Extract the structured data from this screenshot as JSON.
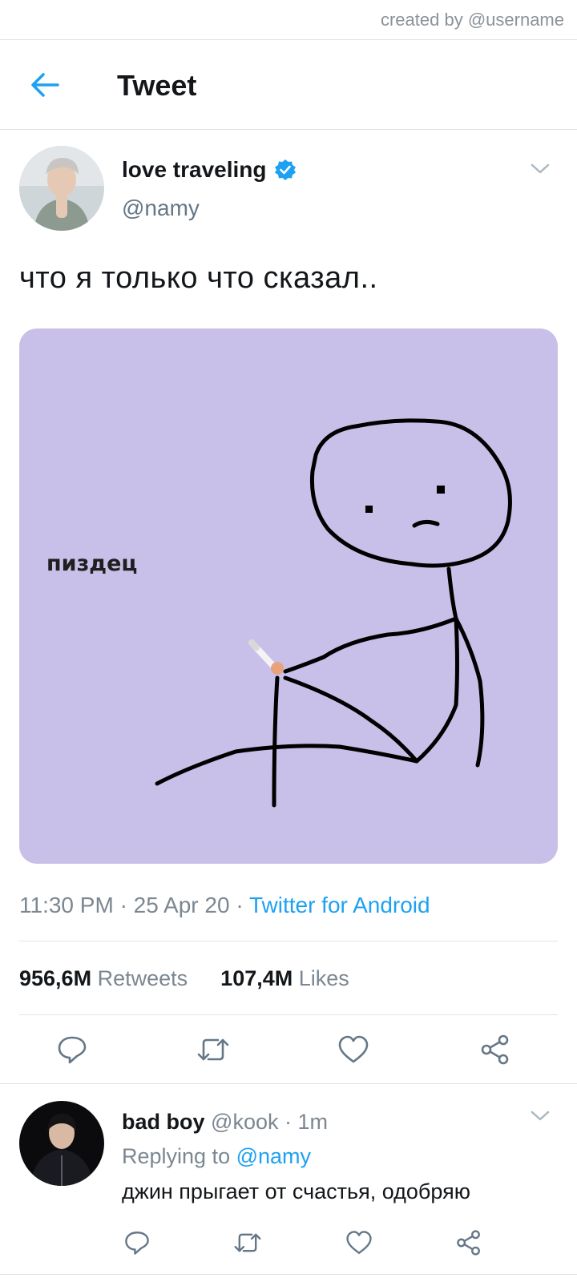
{
  "credit": "created by @username",
  "header": {
    "title": "Tweet"
  },
  "tweet": {
    "display_name": "love traveling",
    "handle": "@namy",
    "verified": true,
    "text": "что я только что сказал..",
    "media_caption": "пиздец",
    "time": "11:30 PM",
    "date": "25 Apr 20",
    "source": "Twitter for Android",
    "retweets_count": "956,6M",
    "retweets_label": "Retweets",
    "likes_count": "107,4M",
    "likes_label": "Likes"
  },
  "reply": {
    "display_name": "bad boy",
    "handle": "@kook",
    "time": "1m",
    "replying_prefix": "Replying to",
    "replying_handle": "@namy",
    "text": "джин прыгает от счастья, одобряю"
  },
  "colors": {
    "accent": "#1da1f2",
    "muted": "#657786",
    "media_bg": "#c8c0e9"
  }
}
